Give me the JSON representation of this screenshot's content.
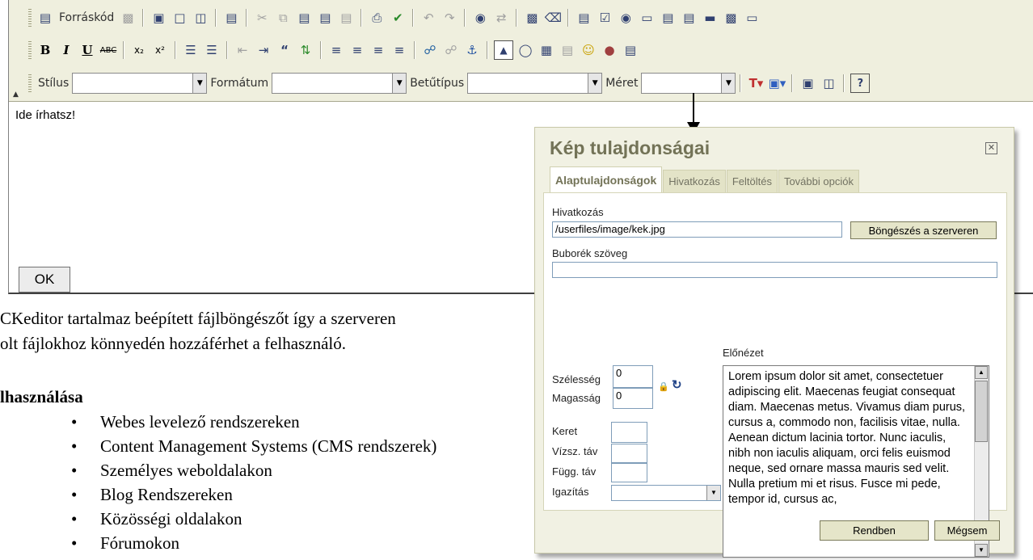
{
  "toolbar": {
    "source_label": "Forráskód",
    "style_label": "Stílus",
    "format_label": "Formátum",
    "font_label": "Betűtípus",
    "size_label": "Méret"
  },
  "editor": {
    "content": "Ide írhatsz!",
    "ok_label": "OK"
  },
  "page": {
    "intro_line1": "CKeditor tartalmaz beépített fájlböngészőt így a szerveren",
    "intro_line2": "olt fájlokhoz könnyedén hozzáférhet a felhasználó.",
    "usage_heading": "lhasználása",
    "usage_items": [
      "Webes levelező rendszereken",
      "Content Management Systems (CMS rendszerek)",
      "Személyes weboldalakon",
      "Blog Rendszereken",
      "Közösségi oldalakon",
      "Fórumokon"
    ]
  },
  "dialog": {
    "title": "Kép tulajdonságai",
    "tabs": [
      "Alaptulajdonságok",
      "Hivatkozás",
      "Feltöltés",
      "További opciók"
    ],
    "url_label": "Hivatkozás",
    "url_value": "/userfiles/image/kek.jpg",
    "browse_label": "Böngészés a szerveren",
    "alt_label": "Buborék szöveg",
    "alt_value": "",
    "width_label": "Szélesség",
    "width_value": "0",
    "height_label": "Magasság",
    "height_value": "0",
    "border_label": "Keret",
    "hspace_label": "Vízsz. táv",
    "vspace_label": "Függ. táv",
    "align_label": "Igazítás",
    "preview_label": "Előnézet",
    "preview_text": "Lorem ipsum dolor sit amet, consectetuer adipiscing elit. Maecenas feugiat consequat diam. Maecenas metus. Vivamus diam purus, cursus a, commodo non, facilisis vitae, nulla. Aenean dictum lacinia tortor. Nunc iaculis, nibh non iaculis aliquam, orci felis euismod neque, sed ornare massa mauris sed velit. Nulla pretium mi et risus. Fusce mi pede, tempor id, cursus ac,",
    "ok_label": "Rendben",
    "cancel_label": "Mégsem"
  },
  "colors": {
    "toolbar_bg": "#efefde",
    "dialog_bg": "#f1f1e3",
    "dialog_title": "#737357"
  }
}
